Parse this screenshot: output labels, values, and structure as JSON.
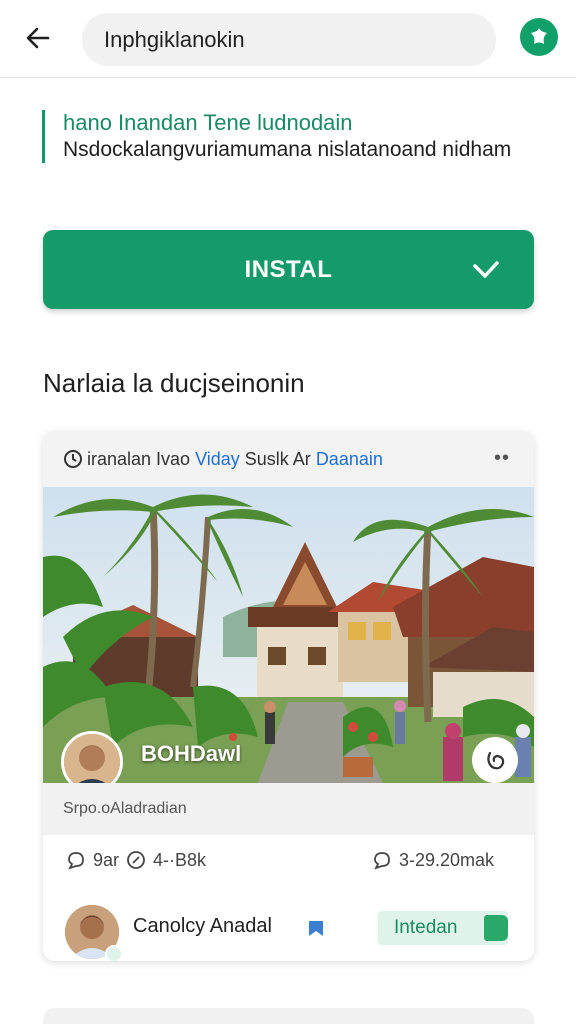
{
  "topbar": {
    "back_icon": "arrow-left-icon",
    "search_value": "Inphgiklanokin",
    "action_icon": "leaf-star-icon",
    "accent": "#12a06a"
  },
  "info": {
    "title": "hano Inandan Tene ludnodain",
    "description": "Nsdockalangvuriamumana nislatanoand nidham"
  },
  "install": {
    "label": "INSTAL",
    "icon": "checkmark-icon",
    "color": "#159a6c"
  },
  "section": {
    "heading": "Narlaia la ducjseinonin"
  },
  "card": {
    "header_prefix": "iranalan Ivao ",
    "header_link1": "Viday",
    "header_mid": " Suslk Ar ",
    "header_link2": "Daanain",
    "more_label": "••",
    "photo_caption": "BOHDawl",
    "subtitle": "Srpo.oAladradian",
    "stats": {
      "comments": "9ar",
      "time": "4-·B8k",
      "views": "3-29.20mak"
    },
    "author_name": "Canolcy Anadal",
    "follow_label": "Intedan"
  }
}
